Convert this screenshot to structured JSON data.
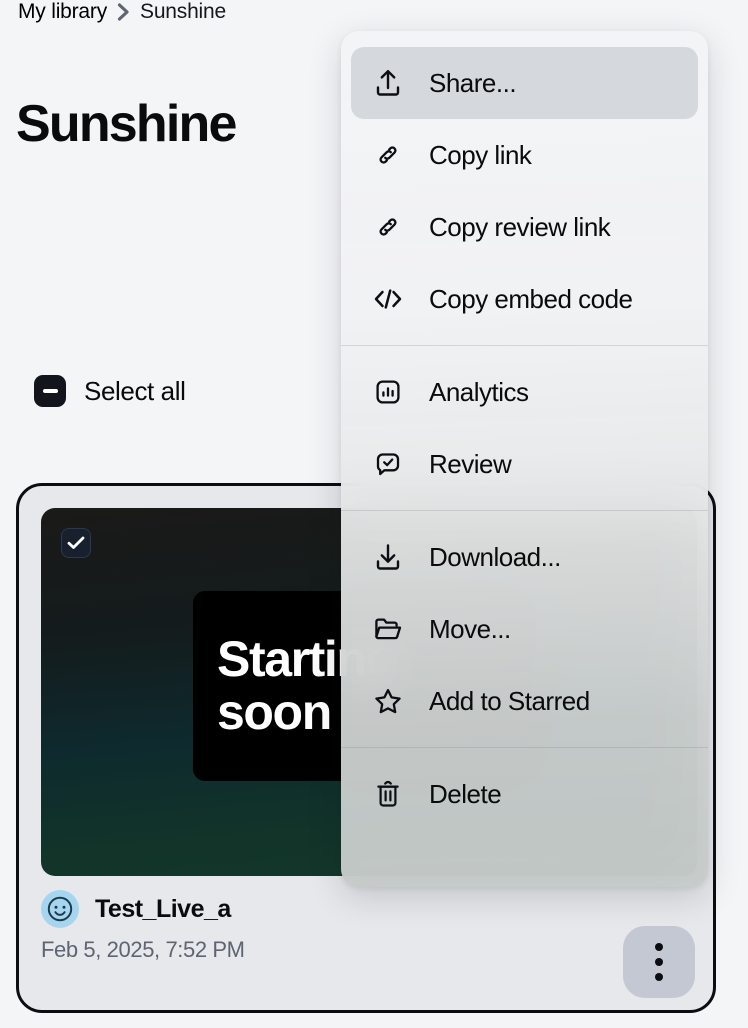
{
  "breadcrumb": {
    "root": "My library",
    "separator_icon": "chevron-right-icon",
    "current": "Sunshine"
  },
  "page_title": "Sunshine",
  "toolbar": {
    "select_all_label": "Select all",
    "select_all_state": "indeterminate"
  },
  "card": {
    "selected": true,
    "thumbnail": {
      "overlay_text": "Starting\nsoon",
      "checkbox_state": "checked"
    },
    "owner_name": "Test_Live_a",
    "timestamp": "Feb 5, 2025, 7:52 PM",
    "avatar_icon": "smiley-face-avatar",
    "more_button_icon": "more-vertical-icon"
  },
  "context_menu": {
    "sections": [
      {
        "items": [
          {
            "label": "Share...",
            "icon": "share-upload-icon",
            "active": true
          },
          {
            "label": "Copy link",
            "icon": "link-icon",
            "active": false
          },
          {
            "label": "Copy review link",
            "icon": "link-icon",
            "active": false
          },
          {
            "label": "Copy embed code",
            "icon": "code-brackets-icon",
            "active": false
          }
        ]
      },
      {
        "items": [
          {
            "label": "Analytics",
            "icon": "bar-chart-icon",
            "active": false
          },
          {
            "label": "Review",
            "icon": "comment-check-icon",
            "active": false
          }
        ]
      },
      {
        "items": [
          {
            "label": "Download...",
            "icon": "download-icon",
            "active": false
          },
          {
            "label": "Move...",
            "icon": "folder-icon",
            "active": false
          },
          {
            "label": "Add to Starred",
            "icon": "star-icon",
            "active": false
          }
        ]
      },
      {
        "items": [
          {
            "label": "Delete",
            "icon": "trash-icon",
            "active": false
          }
        ]
      }
    ]
  },
  "colors": {
    "page_background": "#f4f5f7",
    "card_background": "#e6e8ec",
    "card_border": "#0c0d10",
    "text_primary": "#0a0b0d",
    "text_muted": "#5e6572",
    "avatar_background": "#a6d6ef",
    "menu_active": "#d3d7dc",
    "more_button": "#c3c8d2"
  }
}
